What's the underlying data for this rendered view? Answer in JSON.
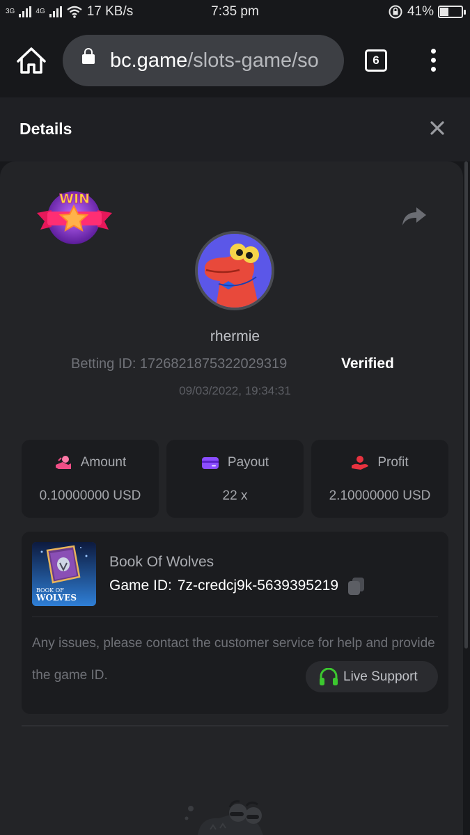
{
  "status_bar": {
    "network_3g": "3G",
    "network_4g": "4G",
    "speed": "17 KB/s",
    "time": "7:35 pm",
    "battery": "41%",
    "battery_level": 0.41
  },
  "browser": {
    "url_domain": "bc.game",
    "url_path": "/slots-game/so",
    "tab_count": "6"
  },
  "details": {
    "title": "Details"
  },
  "bet": {
    "badge_text": "WIN",
    "username": "rhermie",
    "betting_id": "Betting ID: 1726821875322029319",
    "verified": "Verified",
    "timestamp": "09/03/2022, 19:34:31"
  },
  "stats": [
    {
      "label": "Amount",
      "value": "0.10000000 USD",
      "icon": "amount-icon",
      "color": "#f04e86"
    },
    {
      "label": "Payout",
      "value": "22 x",
      "icon": "payout-icon",
      "color": "#8b4dff"
    },
    {
      "label": "Profit",
      "value": "2.10000000 USD",
      "icon": "profit-icon",
      "color": "#e8323f"
    }
  ],
  "game": {
    "name": "Book Of Wolves",
    "id_label": "Game ID:",
    "id_value": "7z-credcj9k-5639395219",
    "thumb_text": "BOOK OF WOLVES"
  },
  "support": {
    "message": "Any issues, please contact the customer service for help and provide the game ID.",
    "button_label": "Live Support",
    "accent": "#3cc72f"
  }
}
